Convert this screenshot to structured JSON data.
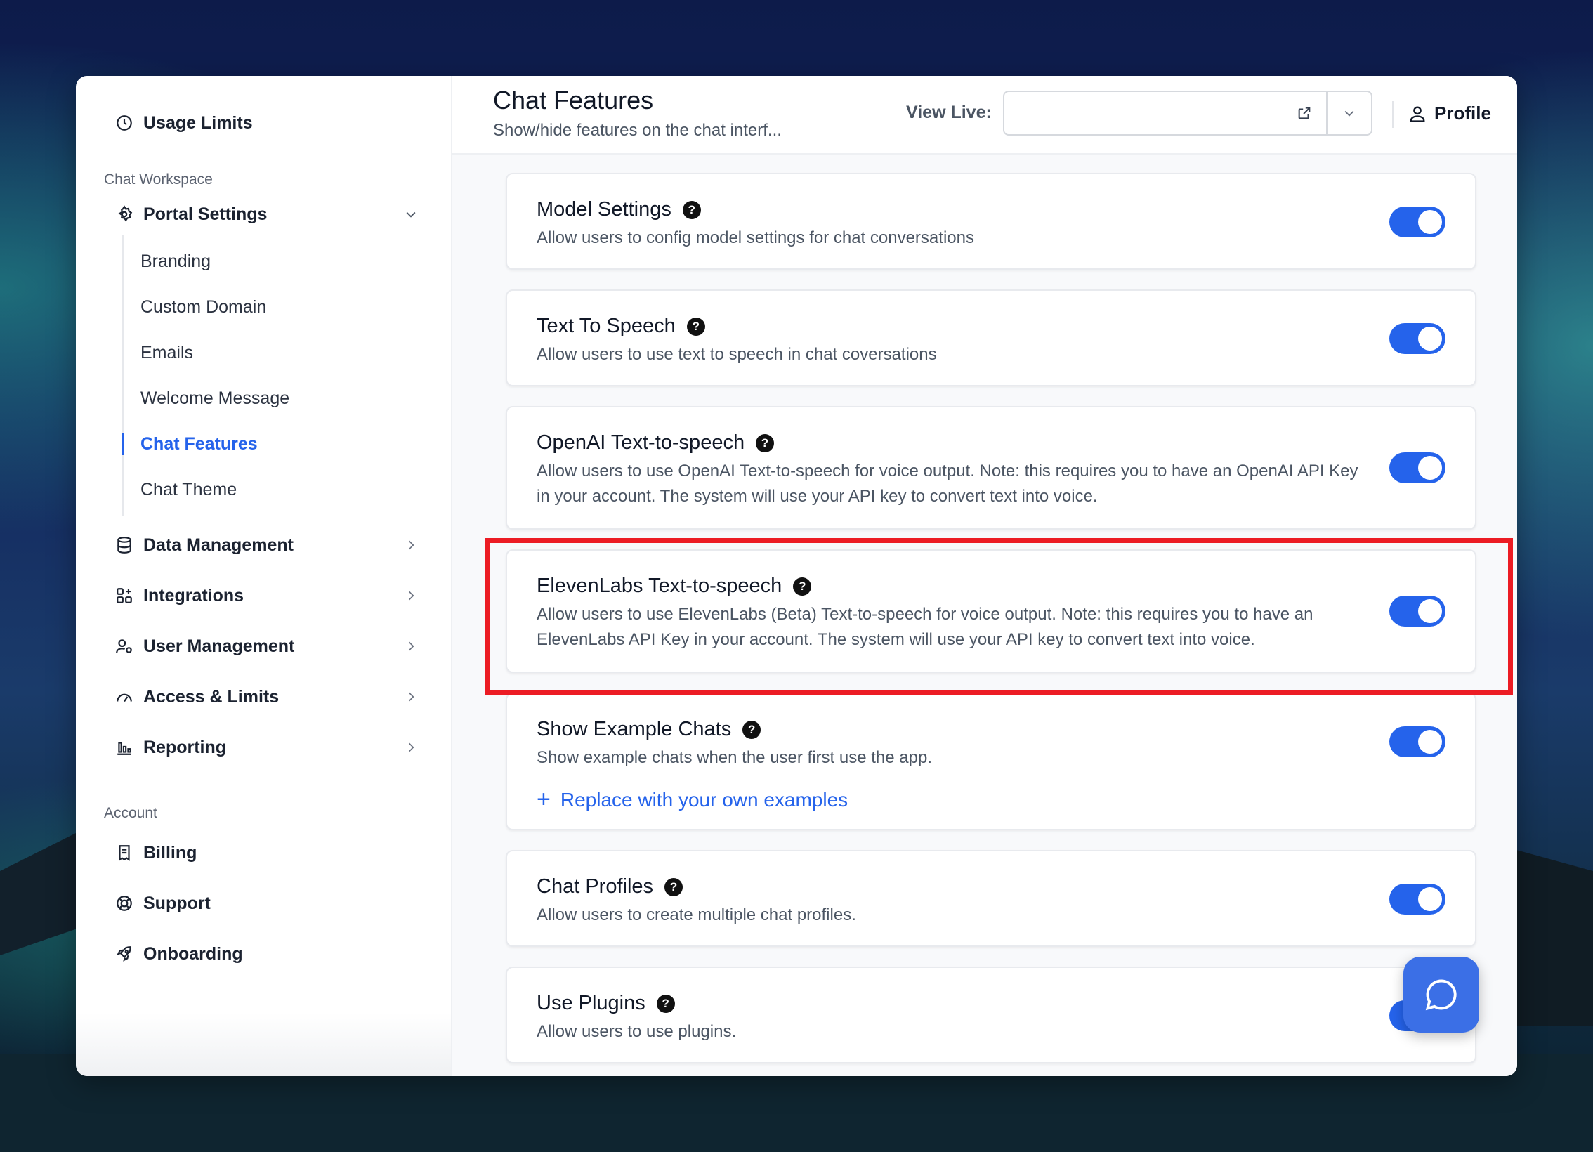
{
  "sidebar": {
    "top_item": {
      "label": "Usage Limits",
      "icon": "clock-icon"
    },
    "section_workspace": "Chat Workspace",
    "portal_settings": {
      "label": "Portal Settings",
      "icon": "gear-icon"
    },
    "portal_sub": [
      "Branding",
      "Custom Domain",
      "Emails",
      "Welcome Message",
      "Chat Features",
      "Chat Theme"
    ],
    "active_sub": "Chat Features",
    "groups": [
      {
        "label": "Data Management",
        "icon": "database-icon"
      },
      {
        "label": "Integrations",
        "icon": "apps-icon"
      },
      {
        "label": "User Management",
        "icon": "users-gear-icon"
      },
      {
        "label": "Access & Limits",
        "icon": "speedometer-icon"
      },
      {
        "label": "Reporting",
        "icon": "bar-chart-icon"
      }
    ],
    "section_account": "Account",
    "account_items": [
      {
        "label": "Billing",
        "icon": "receipt-icon"
      },
      {
        "label": "Support",
        "icon": "lifebuoy-icon"
      },
      {
        "label": "Onboarding",
        "icon": "rocket-icon"
      }
    ]
  },
  "header": {
    "title": "Chat Features",
    "subtitle": "Show/hide features on the chat interf...",
    "view_live_label": "View Live:",
    "view_live_value": "",
    "profile_label": "Profile"
  },
  "features": [
    {
      "title": "Model Settings",
      "description": "Allow users to config model settings for chat conversations",
      "enabled": true
    },
    {
      "title": "Text To Speech",
      "description": "Allow users to use text to speech in chat coversations",
      "enabled": true
    },
    {
      "title": "OpenAI Text-to-speech",
      "description": "Allow users to use OpenAI Text-to-speech for voice output. Note: this requires you to have an OpenAI API Key in your account. The system will use your API key to convert text into voice.",
      "enabled": true
    },
    {
      "title": "ElevenLabs Text-to-speech",
      "description": "Allow users to use ElevenLabs (Beta) Text-to-speech for voice output. Note: this requires you to have an ElevenLabs API Key in your account. The system will use your API key to convert text into voice.",
      "enabled": true
    },
    {
      "title": "Show Example Chats",
      "description": "Show example chats when the user first use the app.",
      "enabled": true,
      "link": "Replace with your own examples"
    },
    {
      "title": "Chat Profiles",
      "description": "Allow users to create multiple chat profiles.",
      "enabled": true
    },
    {
      "title": "Use Plugins",
      "description": "Allow users to use plugins.",
      "enabled": true
    }
  ],
  "help_glyph": "?",
  "colors": {
    "accent": "#2563eb",
    "highlight": "#ec1c24"
  }
}
